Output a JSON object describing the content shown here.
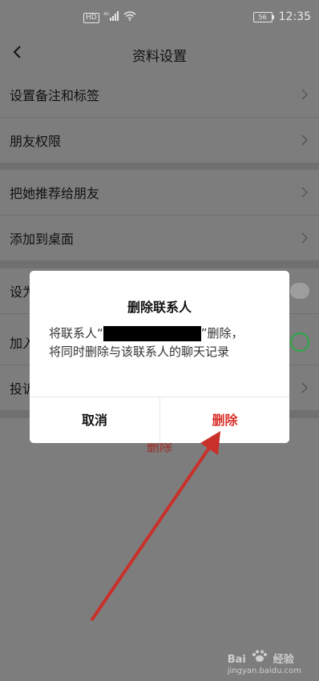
{
  "status_bar": {
    "network_badge": "HD",
    "signal_label": "4G",
    "battery": "56",
    "time": "12:35"
  },
  "header": {
    "title": "资料设置"
  },
  "settings": {
    "set_remark": "设置备注和标签",
    "friend_permissions": "朋友权限",
    "recommend": "把她推荐给朋友",
    "add_to_desktop": "添加到桌面",
    "set_partial": "设为",
    "add_partial": "加入",
    "complain_partial": "投诉",
    "delete_label": "删除"
  },
  "dialog": {
    "title": "删除联系人",
    "message_prefix": "将联系人“",
    "message_suffix": "”删除，",
    "message_line2": "将同时删除与该联系人的聊天记录",
    "cancel": "取消",
    "confirm": "删除"
  },
  "watermark": {
    "brand": "Bai",
    "suffix": "经验",
    "url": "jingyan.baidu.com"
  },
  "colors": {
    "accent_red": "#d9302a",
    "toggle_green": "#2aa846",
    "overlay": "#7d7d7d"
  }
}
